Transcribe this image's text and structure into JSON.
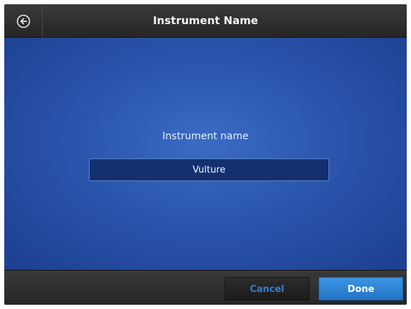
{
  "header": {
    "title": "Instrument Name",
    "back_icon": "back-arrow-circle-icon"
  },
  "form": {
    "label": "Instrument name",
    "input_value": "Vulture"
  },
  "footer": {
    "cancel_label": "Cancel",
    "done_label": "Done"
  },
  "colors": {
    "header_bg": "#2e2e2e",
    "content_bg": "#2a55ad",
    "input_bg": "#14306f",
    "cancel_text": "#2f7fd0",
    "done_bg": "#2f86d8"
  }
}
